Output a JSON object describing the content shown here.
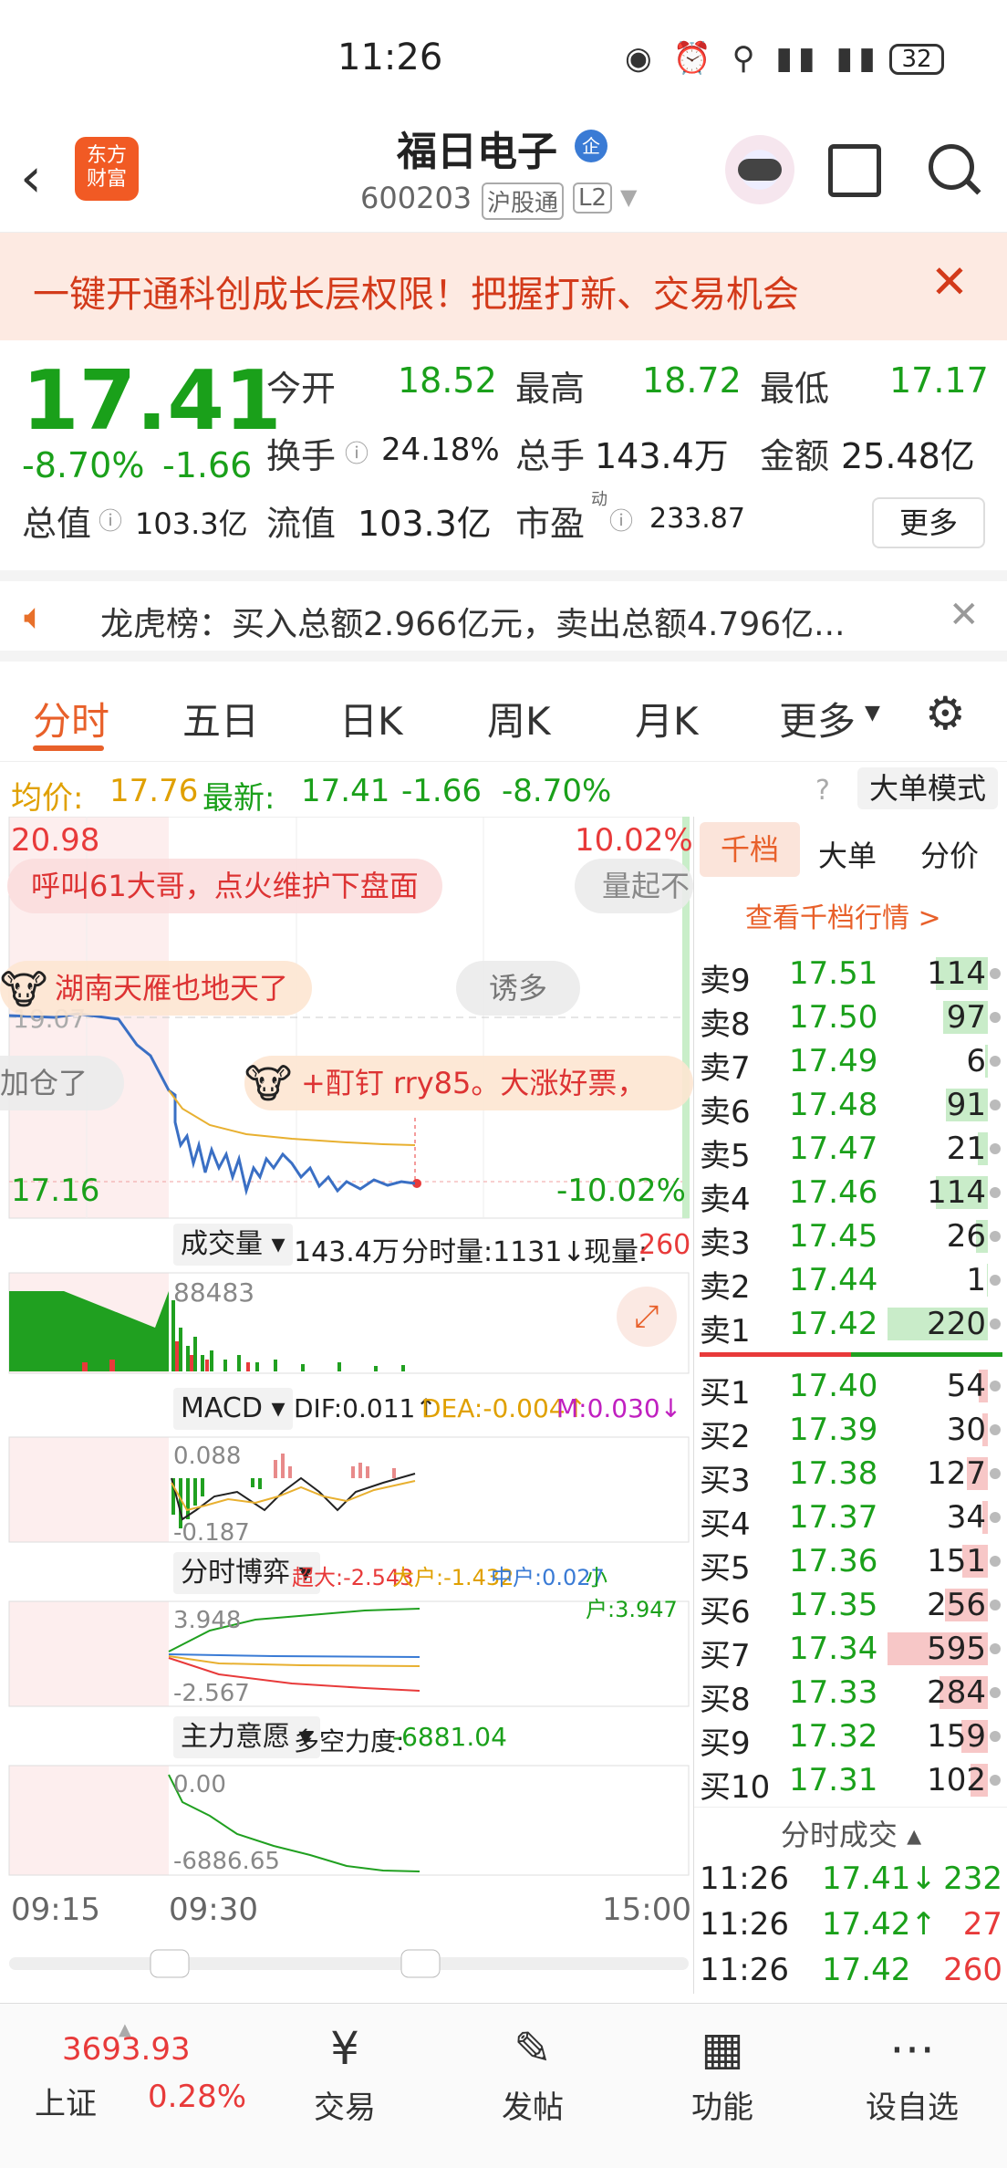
{
  "status": {
    "time": "11:26",
    "battery": "32"
  },
  "header": {
    "name": "福日电子",
    "code": "600203",
    "tag1": "沪股通",
    "tag2": "L2",
    "logo_text1": "东方",
    "logo_text2": "财富",
    "badge": "企"
  },
  "banner": {
    "text": "一键开通科创成长层权限！把握打新、交易机会"
  },
  "quote": {
    "price": "17.41",
    "pct": "-8.70%",
    "chg": "-1.66",
    "open_label": "今开",
    "open": "18.52",
    "high_label": "最高",
    "high": "18.72",
    "low_label": "最低",
    "low": "17.17",
    "turn_label": "换手",
    "turn": "24.18%",
    "vol_label": "总手",
    "vol": "143.4万",
    "amt_label": "金额",
    "amt": "25.48亿",
    "mcap_label": "总值",
    "mcap": "103.3亿",
    "float_label": "流值",
    "float": "103.3亿",
    "pe_label": "市盈",
    "pe_sup": "动",
    "pe": "233.87",
    "more": "更多"
  },
  "lhb": {
    "text": "龙虎榜：买入总额2.966亿元，卖出总额4.796亿..."
  },
  "tabs": [
    "分时",
    "五日",
    "日K",
    "周K",
    "月K",
    "更多"
  ],
  "avg": {
    "avg_label": "均价:",
    "avg": "17.76",
    "last_label": "最新:",
    "last": "17.41",
    "chg": "-1.66",
    "pct": "-8.70%",
    "mode": "大单模式"
  },
  "chart": {
    "top_price": "20.98",
    "top_pct": "10.02%",
    "bot_price": "17.16",
    "bot_pct": "-10.02%",
    "mid_price": "19.07",
    "bubble1": "呼叫61大哥，点火维护下盘面",
    "bubble2": "量起不",
    "bubble3": "湖南天雁也地天了",
    "bubble4": "诱多",
    "bubble5": "加仓了",
    "bubble6": "+酊钉 rry85。大涨好票，",
    "vol_sel": "成交量",
    "vol_total": "143.4万",
    "vol_label": "分时量:1131↓",
    "vol_now_label": "现量:",
    "vol_now": "260",
    "vol_max": "88483",
    "macd_sel": "MACD",
    "dif": "DIF:0.011↑",
    "dea": "DEA:-0.004↑",
    "m": "M:0.030↓",
    "macd_top": "0.088",
    "macd_bot": "-0.187",
    "game_sel": "分时博弈",
    "chaoda": "超大:-2.543",
    "dahu": "大户:-1.432",
    "zhonghu": "中户:0.027",
    "xiaohu": "小户:3.947",
    "game_top": "3.948",
    "game_bot": "-2.567",
    "main_sel": "主力意愿",
    "main_label": "多空力度:",
    "main_val": "-6881.04",
    "main_top": "0.00",
    "main_bot": "-6886.65",
    "t1": "09:15",
    "t2": "09:30",
    "t3": "15:00"
  },
  "book": {
    "tabs": [
      "千档",
      "大单",
      "分价"
    ],
    "link": "查看千档行情 >",
    "asks": [
      {
        "l": "卖9",
        "p": "17.51",
        "v": "114"
      },
      {
        "l": "卖8",
        "p": "17.50",
        "v": "97"
      },
      {
        "l": "卖7",
        "p": "17.49",
        "v": "6"
      },
      {
        "l": "卖6",
        "p": "17.48",
        "v": "91"
      },
      {
        "l": "卖5",
        "p": "17.47",
        "v": "21"
      },
      {
        "l": "卖4",
        "p": "17.46",
        "v": "114"
      },
      {
        "l": "卖3",
        "p": "17.45",
        "v": "26"
      },
      {
        "l": "卖2",
        "p": "17.44",
        "v": "1"
      },
      {
        "l": "卖1",
        "p": "17.42",
        "v": "220"
      }
    ],
    "bids": [
      {
        "l": "买1",
        "p": "17.40",
        "v": "54"
      },
      {
        "l": "买2",
        "p": "17.39",
        "v": "30"
      },
      {
        "l": "买3",
        "p": "17.38",
        "v": "127"
      },
      {
        "l": "买4",
        "p": "17.37",
        "v": "34"
      },
      {
        "l": "买5",
        "p": "17.36",
        "v": "151"
      },
      {
        "l": "买6",
        "p": "17.35",
        "v": "256"
      },
      {
        "l": "买7",
        "p": "17.34",
        "v": "595"
      },
      {
        "l": "买8",
        "p": "17.33",
        "v": "284"
      },
      {
        "l": "买9",
        "p": "17.32",
        "v": "159"
      },
      {
        "l": "买10",
        "p": "17.31",
        "v": "102"
      }
    ],
    "trades_title": "分时成交",
    "trades": [
      {
        "t": "11:26",
        "p": "17.41↓",
        "v": "232"
      },
      {
        "t": "11:26",
        "p": "17.42↑",
        "v": "27"
      },
      {
        "t": "11:26",
        "p": "17.42",
        "v": "260"
      }
    ]
  },
  "bottom": {
    "index": "3693.93",
    "index_name": "上证",
    "index_pct": "0.28%",
    "nav": [
      "交易",
      "发帖",
      "功能",
      "设自选"
    ]
  }
}
